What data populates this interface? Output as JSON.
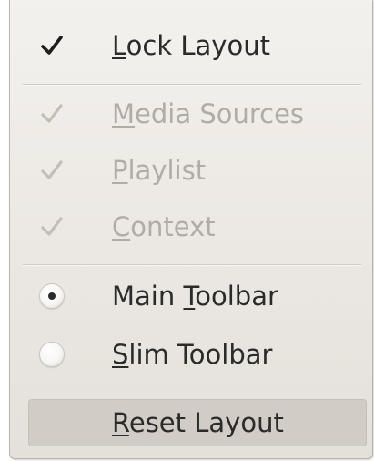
{
  "menu": {
    "items": [
      {
        "pre": "",
        "mnemonic": "L",
        "post": "ock Layout",
        "type": "check",
        "checked": true,
        "enabled": true
      },
      {
        "pre": "",
        "mnemonic": "M",
        "post": "edia Sources",
        "type": "check",
        "checked": true,
        "enabled": false
      },
      {
        "pre": "",
        "mnemonic": "P",
        "post": "laylist",
        "type": "check",
        "checked": true,
        "enabled": false
      },
      {
        "pre": "",
        "mnemonic": "C",
        "post": "ontext",
        "type": "check",
        "checked": true,
        "enabled": false
      },
      {
        "pre": "Main ",
        "mnemonic": "T",
        "post": "oolbar",
        "type": "radio",
        "checked": true,
        "enabled": true
      },
      {
        "pre": "",
        "mnemonic": "S",
        "post": "lim Toolbar",
        "type": "radio",
        "checked": false,
        "enabled": true
      },
      {
        "pre": "",
        "mnemonic": "R",
        "post": "eset Layout",
        "type": "action",
        "checked": false,
        "enabled": true
      }
    ]
  },
  "colors": {
    "text": "#2b2b2b",
    "disabled_text": "#b0aca6",
    "menu_bg": "#ebe8e3",
    "highlight_bg": "#d1cdc6"
  },
  "icons": {
    "check": "checkmark-icon",
    "radio_on": "radio-selected-icon",
    "radio_off": "radio-unselected-icon"
  }
}
